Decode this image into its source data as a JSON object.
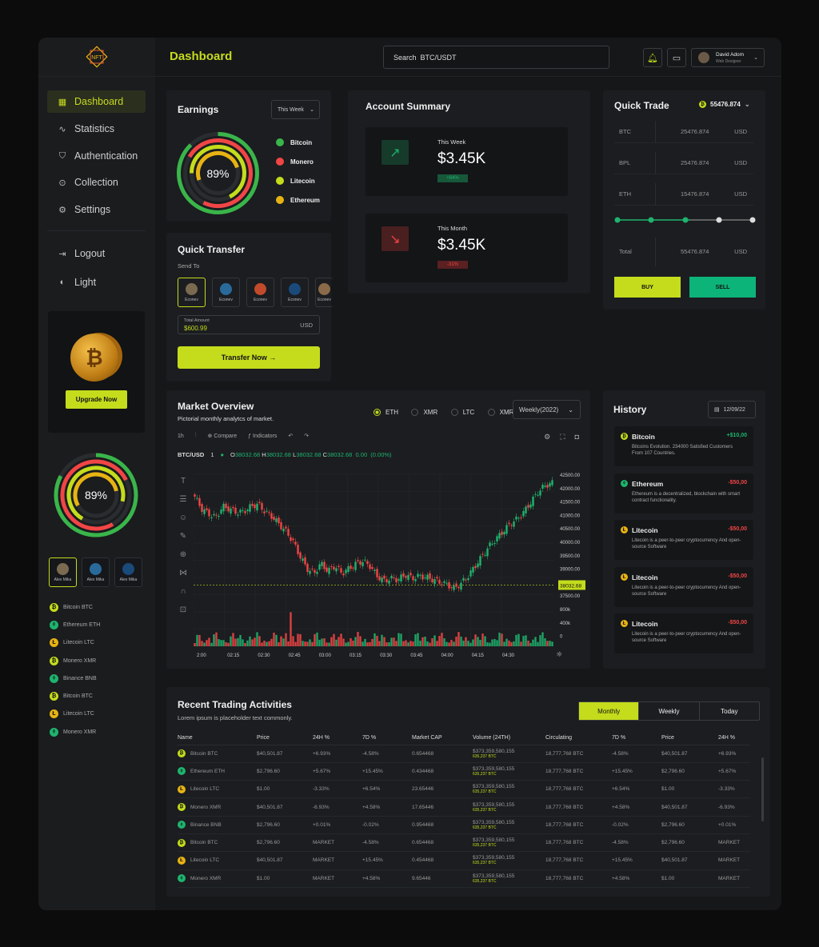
{
  "header": {
    "title": "Dashboard",
    "search_value": "Search  BTC/USDT",
    "user": {
      "name": "David Adom",
      "role": "Web Designer"
    }
  },
  "logo": "NFT",
  "sidebar": {
    "items": [
      {
        "label": "Dashboard",
        "icon": "grid-icon"
      },
      {
        "label": "Statistics",
        "icon": "pulse-icon"
      },
      {
        "label": "Authentication",
        "icon": "shield-icon"
      },
      {
        "label": "Collection",
        "icon": "pin-icon"
      },
      {
        "label": "Settings",
        "icon": "gear-icon"
      }
    ],
    "logout": "Logout",
    "theme": "Light",
    "upgrade_label": "Upgrade Now",
    "ring_value": "89%",
    "avatars": [
      "Alex Mika",
      "Alex Mika",
      "Alex Mika"
    ],
    "coins": [
      {
        "label": "Bitcoin BTC",
        "type": "btc"
      },
      {
        "label": "Ethereum ETH",
        "type": "eth"
      },
      {
        "label": "Litecoin LTC",
        "type": "ltc"
      },
      {
        "label": "Monero XMR",
        "type": "btc"
      },
      {
        "label": "Binance BNB",
        "type": "eth"
      },
      {
        "label": "Bitcoin BTC",
        "type": "btc"
      },
      {
        "label": "Litecoin LTC",
        "type": "ltc"
      },
      {
        "label": "Monero XMR",
        "type": "eth"
      }
    ]
  },
  "earnings": {
    "title": "Earnings",
    "period": "This Week",
    "ring_value": "89%",
    "legend": [
      {
        "label": "Bitcoin",
        "color": "#3ab54a"
      },
      {
        "label": "Monero",
        "color": "#f14545"
      },
      {
        "label": "Litecoin",
        "color": "#c4dc1c"
      },
      {
        "label": "Ethereum",
        "color": "#e7b313"
      }
    ]
  },
  "quick_transfer": {
    "title": "Quick Transfer",
    "send_to": "Send To",
    "contacts": [
      "Econev",
      "Econev",
      "Econev",
      "Econev",
      "Econev"
    ],
    "amount_label": "Total Amount",
    "amount_value": "$600.99",
    "currency": "USD",
    "button": "Transfer Now"
  },
  "account_summary": {
    "title": "Account Summary",
    "week": {
      "label": "This Week",
      "value": "$3.45K",
      "change": "+84%"
    },
    "month": {
      "label": "This Month",
      "value": "$3.45K",
      "change": "-31%"
    }
  },
  "quick_trade": {
    "title": "Quick Trade",
    "balance": "55476.874",
    "rows": [
      {
        "c1": "BTC",
        "c2": "25476.874",
        "c3": "USD"
      },
      {
        "c1": "BPL",
        "c2": "25476.874",
        "c3": "USD"
      },
      {
        "c1": "ETH",
        "c2": "15476.874",
        "c3": "USD"
      }
    ],
    "total": {
      "c1": "Total",
      "c2": "55476.874",
      "c3": "USD"
    },
    "buy": "BUY",
    "sell": "SELL"
  },
  "market": {
    "title": "Market Overview",
    "subtitle": "Pictorial monthly analytcs of market.",
    "pairs": [
      "ETH",
      "XMR",
      "LTC",
      "XMR"
    ],
    "period": "Weekly(2022)",
    "toolbar": {
      "interval": "1h",
      "compare": "Compare",
      "indicators": "Indicators"
    },
    "symbol": "BTC/USD",
    "symbol_n": "1",
    "ohlc": {
      "o": "38032.68",
      "h": "38032.68",
      "l": "38032.68",
      "c": "38032.68",
      "chg": "0.00",
      "pct": "(0.00%)"
    },
    "price_tag": "38032.68"
  },
  "chart_data": {
    "type": "candlestick",
    "x_ticks": [
      "2:00",
      "02:15",
      "02:30",
      "02:45",
      "03:00",
      "03:15",
      "03:30",
      "03:45",
      "04:00",
      "04:15",
      "04:30"
    ],
    "y_ticks": [
      "42500.00",
      "42000.00",
      "41500.00",
      "41000.00",
      "40500.00",
      "40000.00",
      "39500.00",
      "39000.00",
      "38500.00",
      "38032.68",
      "37500.00",
      "800k",
      "400k",
      "0"
    ],
    "ylim": [
      37500,
      42500
    ],
    "close_series": [
      41600,
      41100,
      40900,
      40750,
      41200,
      41100,
      40950,
      41000,
      41200,
      41300,
      41000,
      40800,
      40500,
      40200,
      39800,
      39200,
      38700,
      38500,
      38900,
      38600,
      38800,
      38500,
      38700,
      38900,
      39000,
      38800,
      38400,
      38200,
      38300,
      38250,
      38450,
      38300,
      38400,
      38350,
      38250,
      38150,
      38050,
      37900,
      38100,
      38400,
      38800,
      39200,
      39600,
      39900,
      40200,
      40500,
      40700,
      41000,
      41400,
      41800,
      42050,
      42150
    ]
  },
  "history": {
    "title": "History",
    "date": "12/09/22",
    "items": [
      {
        "name": "Bitcoin",
        "amount": "+$10,00",
        "desc": "Bitcoins Evolution. 234000 Satisfied Customers From 107 Countries.",
        "type": "btc"
      },
      {
        "name": "Ethereum",
        "amount": "-$50,00",
        "desc": "Ethereum is a decentralized, blockchain with smart contract functionality.",
        "type": "eth"
      },
      {
        "name": "Litecoin",
        "amount": "-$50,00",
        "desc": "Litecoin is a peer-to-peer cryptocurrency And open-source Software",
        "type": "ltc"
      },
      {
        "name": "Litecoin",
        "amount": "-$50,00",
        "desc": "Litecoin is a peer-to-peer cryptocurrency And open-source Software",
        "type": "ltc"
      },
      {
        "name": "Litecoin",
        "amount": "-$50,00",
        "desc": "Litecoin is a peer-to-peer cryptocurrency And open-source Software",
        "type": "ltc"
      }
    ]
  },
  "recent": {
    "title": "Recent Trading Activities",
    "subtitle": "Lorem ipsum is placeholder text commonly.",
    "tabs": [
      "Monthly",
      "Weekly",
      "Today"
    ],
    "columns": [
      "Name",
      "Price",
      "24H %",
      "7D %",
      "Market CAP",
      "Volume (24TH)",
      "Circulating",
      "7D %",
      "Price",
      "24H %"
    ],
    "rows": [
      {
        "name": "Bitcoin BTC",
        "type": "btc",
        "price": "$40,501.87",
        "h24": "+6.93%",
        "d7": "-4.58%",
        "cap": "0.654468",
        "vol": "$373,359,580,155",
        "vol2": "635,237 BTC",
        "circ": "18,777,768 BTC",
        "d7b": "-4.58%",
        "price2": "$40,501.87",
        "h24b": "+6.93%"
      },
      {
        "name": "Ethereum ETH",
        "type": "eth",
        "price": "$2,796.60",
        "h24": "+5.67%",
        "d7": "+15.45%",
        "cap": "0.434468",
        "vol": "$373,359,580,155",
        "vol2": "635,237 BTC",
        "circ": "18,777,768 BTC",
        "d7b": "+15.45%",
        "price2": "$2,796.60",
        "h24b": "+5.67%"
      },
      {
        "name": "Litecoin LTC",
        "type": "ltc",
        "price": "$1.00",
        "h24": "-3.33%",
        "d7": "+6.54%",
        "cap": "23.65446",
        "vol": "$373,359,580,155",
        "vol2": "635,237 BTC",
        "circ": "18,777,768 BTC",
        "d7b": "+6.54%",
        "price2": "$1.00",
        "h24b": "-3.33%"
      },
      {
        "name": "Monero XMR",
        "type": "btc",
        "price": "$40,501.87",
        "h24": "-6.93%",
        "d7": "+4.58%",
        "cap": "17.65446",
        "vol": "$373,359,580,155",
        "vol2": "635,237 BTC",
        "circ": "18,777,768 BTC",
        "d7b": "+4.58%",
        "price2": "$40,501.87",
        "h24b": "-6.93%"
      },
      {
        "name": "Binance BNB",
        "type": "eth",
        "price": "$2,796.60",
        "h24": "+0.01%",
        "d7": "-0.02%",
        "cap": "0.954468",
        "vol": "$373,359,580,155",
        "vol2": "635,237 BTC",
        "circ": "18,777,768 BTC",
        "d7b": "-0.02%",
        "price2": "$2,796.60",
        "h24b": "+0.01%"
      },
      {
        "name": "Bitcoin BTC",
        "type": "btc",
        "price": "$2,796.60",
        "h24": "MARKET",
        "d7": "-4.58%",
        "cap": "0.654468",
        "vol": "$373,359,580,155",
        "vol2": "635,237 BTC",
        "circ": "18,777,768 BTC",
        "d7b": "-4.58%",
        "price2": "$2,796.60",
        "h24b": "MARKET"
      },
      {
        "name": "Litecoin LTC",
        "type": "ltc",
        "price": "$40,501.87",
        "h24": "MARKET",
        "d7": "+15.45%",
        "cap": "0.454468",
        "vol": "$373,359,580,155",
        "vol2": "635,237 BTC",
        "circ": "18,777,768 BTC",
        "d7b": "+15.45%",
        "price2": "$40,501.87",
        "h24b": "MARKET"
      },
      {
        "name": "Monero XMR",
        "type": "eth",
        "price": "$1.00",
        "h24": "MARKET",
        "d7": "+4.58%",
        "cap": "9.65446",
        "vol": "$373,359,580,155",
        "vol2": "635,237 BTC",
        "circ": "18,777,768 BTC",
        "d7b": "+4.58%",
        "price2": "$1.00",
        "h24b": "MARKET"
      }
    ]
  }
}
